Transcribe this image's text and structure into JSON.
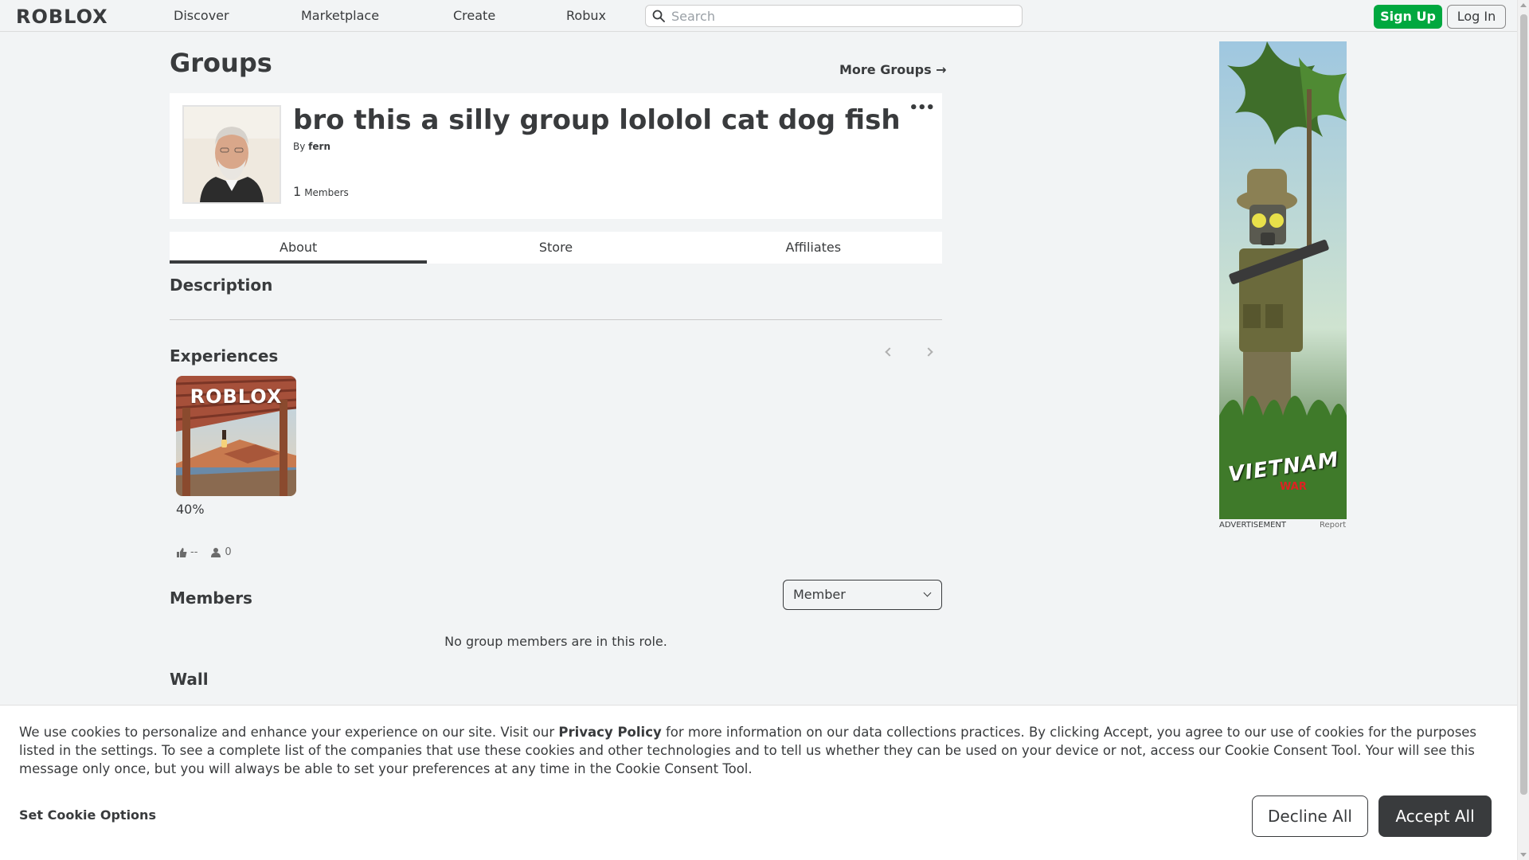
{
  "nav": {
    "logo": "ROBLOX",
    "links": [
      "Discover",
      "Marketplace",
      "Create",
      "Robux"
    ],
    "search_placeholder": "Search",
    "signup_label": "Sign Up",
    "login_label": "Log In"
  },
  "page": {
    "title": "Groups",
    "more_groups": "More Groups →"
  },
  "group": {
    "name": "bro this a silly group lololol cat dog fish",
    "by_label": "By",
    "owner": "fern",
    "member_count": "1",
    "members_label": "Members",
    "menu_icon": "more-dots-icon"
  },
  "tabs": [
    "About",
    "Store",
    "Affiliates"
  ],
  "sections": {
    "description": "Description",
    "experiences": "Experiences",
    "members": "Members",
    "wall": "Wall"
  },
  "experience": {
    "tile_logo": "ROBLOX",
    "rating": "40%",
    "likes": "--",
    "players": "0"
  },
  "members": {
    "role_selected": "Member",
    "empty_message": "No group members are in this role."
  },
  "ad": {
    "label": "ADVERTISEMENT",
    "report": "Report",
    "banner_text": "VIETNAM",
    "banner_sub": "WAR"
  },
  "cookie": {
    "text_before": "We use cookies to personalize and enhance your experience on our site. Visit our ",
    "privacy_link": "Privacy Policy",
    "text_after": " for more information on our data collections practices. By clicking Accept, you agree to our use of cookies for the purposes listed in the settings. To see a complete list of the companies that use these cookies and other technologies and to tell us whether they can be used on your device or not, access our Cookie Consent Tool. Your will see this message only once, but you will always be able to set your preferences at any time in the Cookie Consent Tool.",
    "options_label": "Set Cookie Options",
    "decline_label": "Decline All",
    "accept_label": "Accept All"
  },
  "colors": {
    "background": "#f2f4f5",
    "text": "#393b3d",
    "signup_green": "#00a83f",
    "accept_dark": "#393b3d"
  }
}
